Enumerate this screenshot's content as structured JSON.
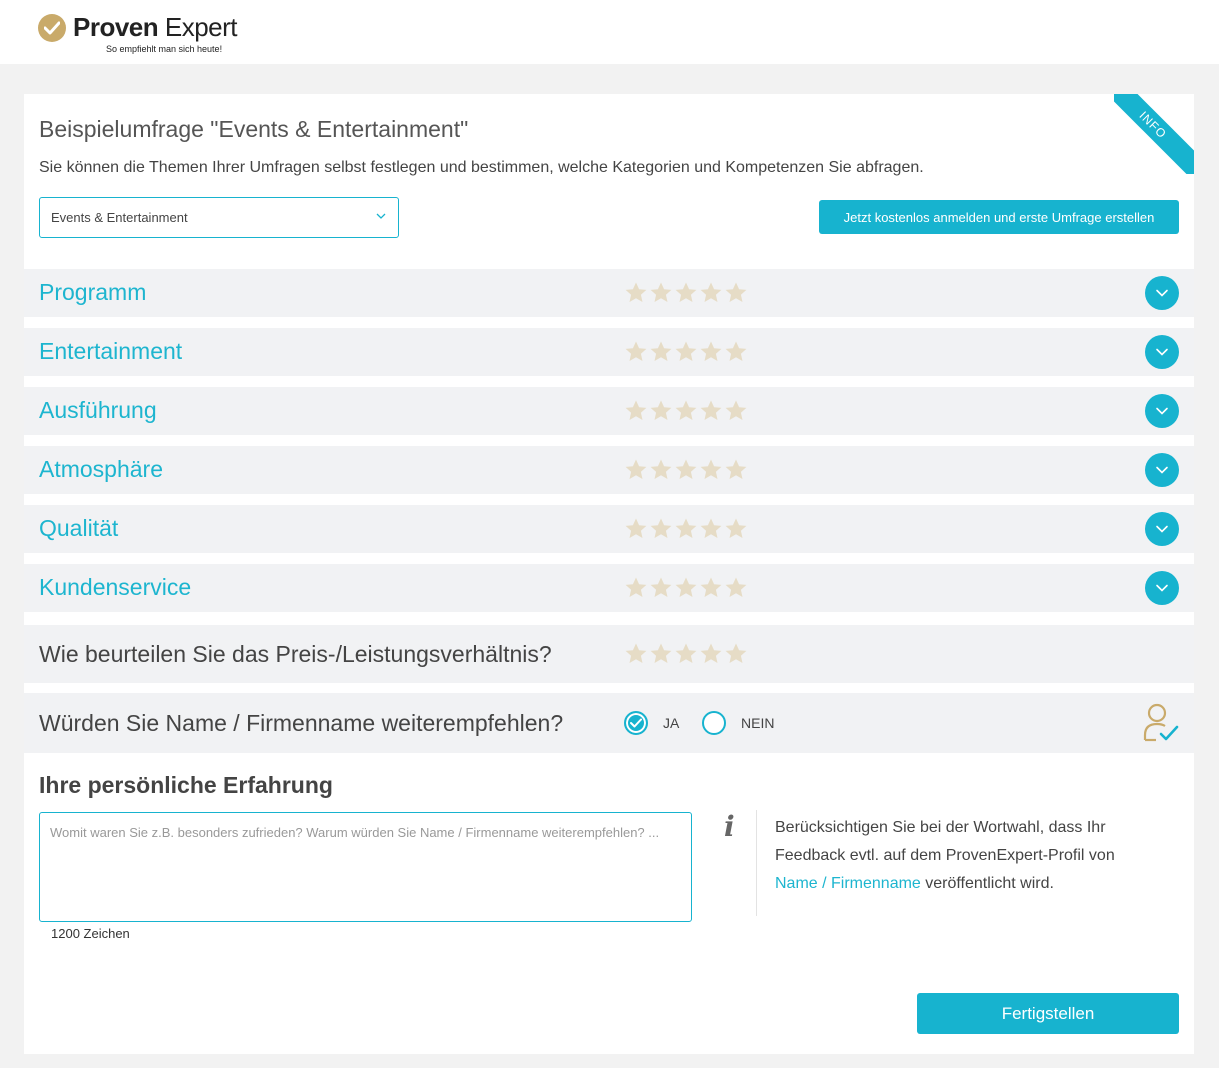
{
  "brand": {
    "name_bold": "Proven",
    "name_regular": " Expert",
    "tagline": "So empfiehlt man sich heute!",
    "gold": "#c9aa6a"
  },
  "theme": {
    "accent": "#17b3cf",
    "row_bg": "#f1f2f4",
    "star_color": "#e6dcc6"
  },
  "info_badge": "INFO",
  "survey": {
    "title": "Beispielumfrage \"Events & Entertainment\"",
    "description": "Sie können die Themen Ihrer Umfragen selbst festlegen und bestimmen, welche Kategorien und Kompetenzen Sie abfragen.",
    "category_select_value": "Events & Entertainment",
    "cta_label": "Jetzt kostenlos anmelden und erste Umfrage erstellen"
  },
  "categories": [
    {
      "label": "Programm",
      "rating": 0,
      "max": 5
    },
    {
      "label": "Entertainment",
      "rating": 0,
      "max": 5
    },
    {
      "label": "Ausführung",
      "rating": 0,
      "max": 5
    },
    {
      "label": "Atmosphäre",
      "rating": 0,
      "max": 5
    },
    {
      "label": "Qualität",
      "rating": 0,
      "max": 5
    },
    {
      "label": "Kundenservice",
      "rating": 0,
      "max": 5
    }
  ],
  "price_question": {
    "label": "Wie beurteilen Sie das Preis-/Leistungsverhältnis?",
    "rating": 0,
    "max": 5
  },
  "recommend_question": {
    "label": "Würden Sie Name / Firmenname weiterempfehlen?",
    "yes_label": "JA",
    "no_label": "NEIN",
    "selected": "JA"
  },
  "experience": {
    "title": "Ihre persönliche Erfahrung",
    "placeholder": "Womit waren Sie z.B. besonders zufrieden? Warum würden Sie Name / Firmenname weiterempfehlen? ...",
    "value": "",
    "char_count": "1200 Zeichen",
    "info_text_before": "Berücksichtigen Sie bei der Wortwahl, dass Ihr Feedback evtl. auf dem ProvenExpert-Profil von ",
    "info_link": "Name / Firmenname",
    "info_text_after": " veröffentlicht wird."
  },
  "finish_label": "Fertigstellen"
}
